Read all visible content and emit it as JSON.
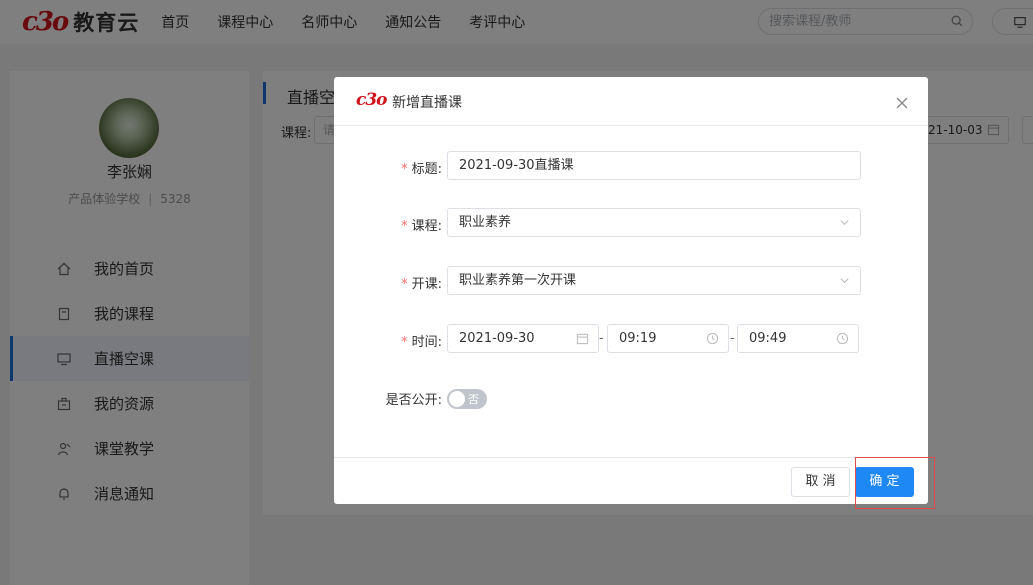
{
  "header": {
    "logo_mark": "c3o",
    "logo_text": "教育云",
    "nav": [
      "首页",
      "课程中心",
      "名师中心",
      "通知公告",
      "考评中心"
    ],
    "search_placeholder": "搜索课程/教师"
  },
  "user": {
    "name": "李张娴",
    "school": "产品体验学校",
    "separator": "|",
    "id": "5328"
  },
  "sidebar": {
    "items": [
      {
        "label": "我的首页",
        "icon": "home-icon"
      },
      {
        "label": "我的课程",
        "icon": "book-icon"
      },
      {
        "label": "直播空课",
        "icon": "monitor-icon",
        "active": true
      },
      {
        "label": "我的资源",
        "icon": "box-icon"
      },
      {
        "label": "课堂教学",
        "icon": "teacher-icon"
      },
      {
        "label": "消息通知",
        "icon": "bell-icon"
      }
    ]
  },
  "main": {
    "title": "直播空",
    "filter_label": "课程:",
    "filter_course_placeholder": "请",
    "filter_date": "21-10-03"
  },
  "dialog": {
    "logo_mark": "c3o",
    "title": "新增直播课",
    "fields": {
      "title_label": "标题:",
      "title_value": "2021-09-30直播课",
      "course_label": "课程:",
      "course_value": "职业素养",
      "class_label": "开课:",
      "class_value": "职业素养第一次开课",
      "time_label": "时间:",
      "date_value": "2021-09-30",
      "start_time": "09:19",
      "end_time": "09:49",
      "dash": "-",
      "public_label": "是否公开:",
      "public_switch_text": "否",
      "required_mark": "*"
    },
    "cancel_label": "取 消",
    "ok_label": "确 定"
  },
  "colors": {
    "brand": "#d0121b",
    "primary": "#1e88f5",
    "required": "#f56c6c"
  }
}
